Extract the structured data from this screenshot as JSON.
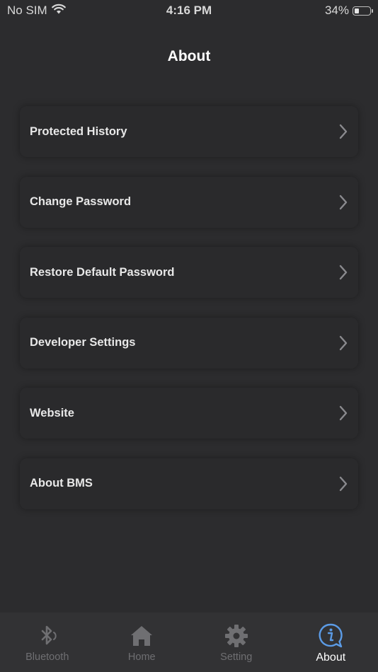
{
  "status_bar": {
    "carrier": "No SIM",
    "time": "4:16 PM",
    "battery_percent": "34%",
    "battery_level": 0.34
  },
  "header": {
    "title": "About"
  },
  "menu": {
    "items": [
      {
        "label": "Protected History"
      },
      {
        "label": "Change Password"
      },
      {
        "label": "Restore Default Password"
      },
      {
        "label": "Developer Settings"
      },
      {
        "label": "Website"
      },
      {
        "label": "About BMS"
      }
    ]
  },
  "tab_bar": {
    "tabs": [
      {
        "label": "Bluetooth",
        "icon": "bluetooth-icon"
      },
      {
        "label": "Home",
        "icon": "home-icon"
      },
      {
        "label": "Setting",
        "icon": "gear-icon"
      },
      {
        "label": "About",
        "icon": "info-icon",
        "active": true
      }
    ]
  },
  "colors": {
    "background": "#2c2c2e",
    "card": "#2a2a2c",
    "tab_bar": "#323234",
    "tab_inactive": "#6f6f72",
    "accent": "#5b9be6"
  }
}
